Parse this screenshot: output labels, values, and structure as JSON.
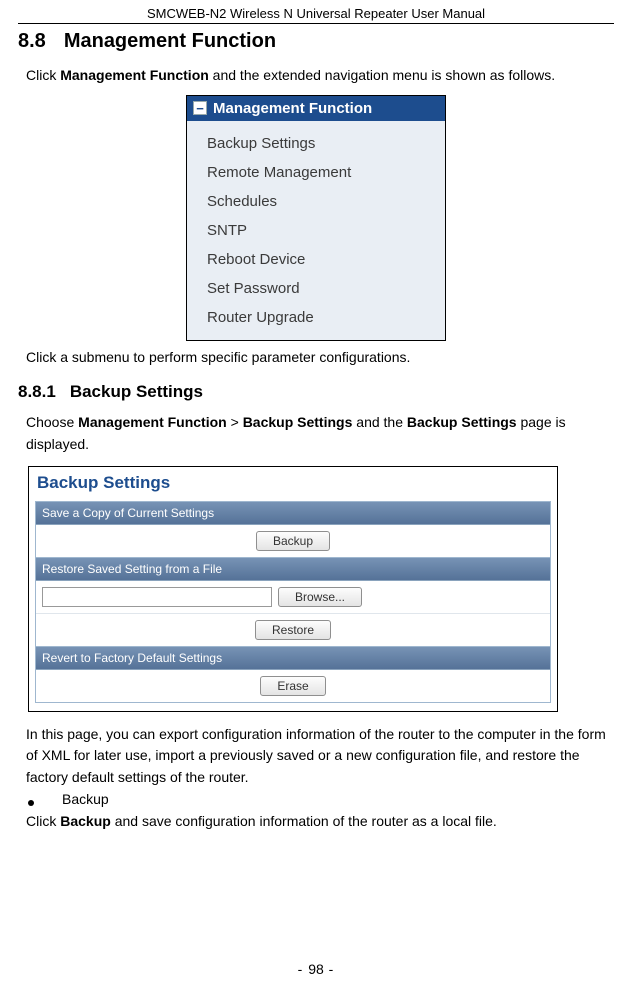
{
  "header": {
    "product": "SMCWEB-N2 Wireless N Universal Repeater User Manual"
  },
  "section": {
    "number": "8.8",
    "title": "Management Function",
    "intro_a": "Click ",
    "intro_b_bold": "Management Function",
    "intro_c": " and the extended navigation menu is shown as follows."
  },
  "menu_fig": {
    "chip": "−",
    "heading": "Management Function",
    "items": [
      "Backup Settings",
      "Remote Management",
      "Schedules",
      "SNTP",
      "Reboot Device",
      "Set Password",
      "Router Upgrade"
    ]
  },
  "after_menu": "Click a submenu to perform specific parameter configurations.",
  "subsection": {
    "number": "8.8.1",
    "title": "Backup Settings",
    "intro_a": "Choose ",
    "intro_b_bold": "Management Function",
    "intro_c": " > ",
    "intro_d_bold": "Backup Settings",
    "intro_e": " and the ",
    "intro_f_bold": "Backup Settings",
    "intro_g": " page is displayed."
  },
  "backup_fig": {
    "title": "Backup Settings",
    "row1_header": "Save a Copy of Current Settings",
    "row1_button": "Backup",
    "row2_header": "Restore Saved Setting from a File",
    "row2_browse": "Browse...",
    "row2_restore": "Restore",
    "row3_header": "Revert to Factory Default Settings",
    "row3_button": "Erase"
  },
  "after_backup": "In this page, you can export configuration information of the router to the computer in the form of XML for later use, import a previously saved or a new configuration file, and restore the factory default settings of the router.",
  "bullet_item": "Backup",
  "bullet_text_a": "Click ",
  "bullet_text_b_bold": "Backup",
  "bullet_text_c": " and save configuration information of the router as a local file.",
  "footer": {
    "left": "- ",
    "page": "98",
    "right": " -"
  }
}
